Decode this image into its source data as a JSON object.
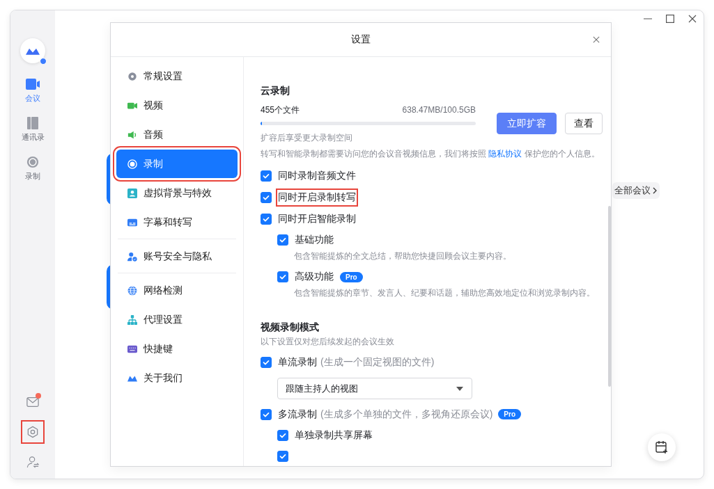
{
  "rail": {
    "items": [
      {
        "label": "会议",
        "kind": "video",
        "selected": true
      },
      {
        "label": "通讯录",
        "kind": "book",
        "selected": false
      },
      {
        "label": "录制",
        "kind": "record",
        "selected": false
      }
    ],
    "bottom": [
      {
        "kind": "mail",
        "unread": true
      },
      {
        "kind": "settings",
        "highlighted": true
      },
      {
        "kind": "account"
      }
    ]
  },
  "background": {
    "all_meetings_button": "全部会议"
  },
  "dialog": {
    "title": "设置",
    "sidebar": {
      "groups": [
        [
          {
            "label": "常规设置",
            "kind": "gear",
            "selected": false
          },
          {
            "label": "视频",
            "kind": "camera",
            "selected": false
          },
          {
            "label": "音频",
            "kind": "speaker",
            "selected": false
          },
          {
            "label": "录制",
            "kind": "record",
            "selected": true,
            "highlighted": true
          },
          {
            "label": "虚拟背景与特效",
            "kind": "portrait",
            "selected": false
          },
          {
            "label": "字幕和转写",
            "kind": "caption",
            "selected": false
          }
        ],
        [
          {
            "label": "账号安全与隐私",
            "kind": "account",
            "selected": false
          }
        ],
        [
          {
            "label": "网络检测",
            "kind": "globe",
            "selected": false
          },
          {
            "label": "代理设置",
            "kind": "network",
            "selected": false
          },
          {
            "label": "快捷键",
            "kind": "keyboard",
            "selected": false
          },
          {
            "label": "关于我们",
            "kind": "logo",
            "selected": false
          }
        ]
      ]
    },
    "cloud_recording": {
      "title": "云录制",
      "file_count": "455个文件",
      "usage": "638.47MB/100.5GB",
      "level": 0.006,
      "hint": "扩容后享受更大录制空间",
      "buttons": [
        "立即扩容",
        "查看"
      ],
      "privacy_note": {
        "before": "转写和智能录制都需要访问您的会议音视频信息，我们将按照 ",
        "link": "隐私协议",
        "after": " 保护您的个人信息。"
      },
      "options": [
        {
          "label": "同时录制音频文件",
          "checked": true
        },
        {
          "label": "同时开启录制转写",
          "checked": true,
          "highlighted": true
        },
        {
          "label": "同时开启智能录制",
          "checked": true,
          "children": [
            {
              "label": "基础功能",
              "checked": true,
              "description": "包含智能提炼的全文总结，帮助您快捷回顾会议主要内容。"
            },
            {
              "label": "高级功能",
              "checked": true,
              "badge": "Pro",
              "description": "包含智能提炼的章节、发言人、纪要和话题，辅助您高效地定位和浏览录制内容。"
            }
          ]
        }
      ]
    },
    "video_recording_mode": {
      "title": "视频录制模式",
      "subtitle": "以下设置仅对您后续发起的会议生效",
      "options": [
        {
          "label": "单流录制",
          "note": "(生成一个固定视图的文件)",
          "checked": true,
          "dropdown": "跟随主持人的视图"
        },
        {
          "label": "多流录制",
          "note": "(生成多个单独的文件，多视角还原会议)",
          "checked": true,
          "badge": "Pro",
          "children": [
            {
              "label": "单独录制共享屏幕",
              "checked": true
            },
            {
              "checked": true
            }
          ]
        }
      ]
    }
  }
}
